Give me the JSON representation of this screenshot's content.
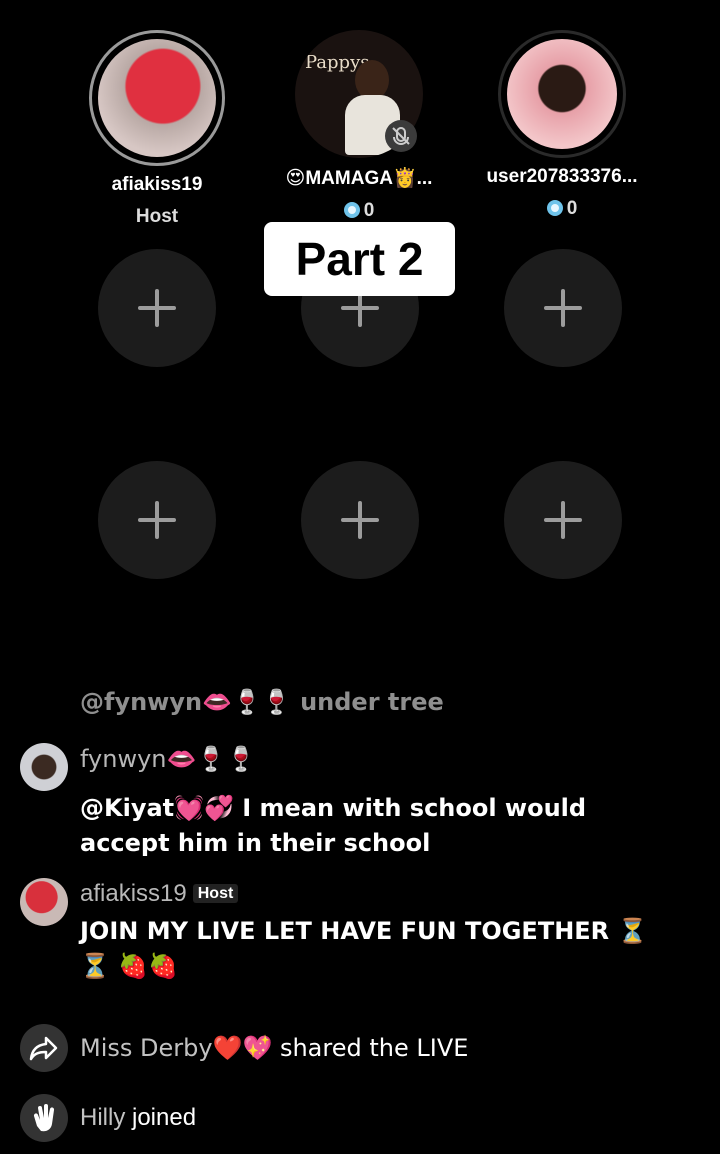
{
  "guests": [
    {
      "name": "afiakiss19",
      "sub": "Host"
    },
    {
      "name": "😍MAMAGA👸...",
      "count": "0",
      "poster_text": "Pappys"
    },
    {
      "name": "user207833376...",
      "count": "0"
    }
  ],
  "overlay_label": "Part 2",
  "pinned": "@fynwyn👄🍷🍷 under tree",
  "comments": [
    {
      "user": "fynwyn👄🍷🍷",
      "text": "@Kiyat💓💞 I mean with school would accept him in their school"
    },
    {
      "user": "afiakiss19",
      "badge": "Host",
      "text": "JOIN MY LIVE LET HAVE FUN TOGETHER ⏳⏳ 🍓🍓"
    }
  ],
  "events": [
    {
      "user": "Miss Derby❤️💖",
      "action": "shared the LIVE",
      "icon": "share-icon"
    },
    {
      "user": "Hilly",
      "action": "joined",
      "icon": "wave-icon"
    }
  ]
}
